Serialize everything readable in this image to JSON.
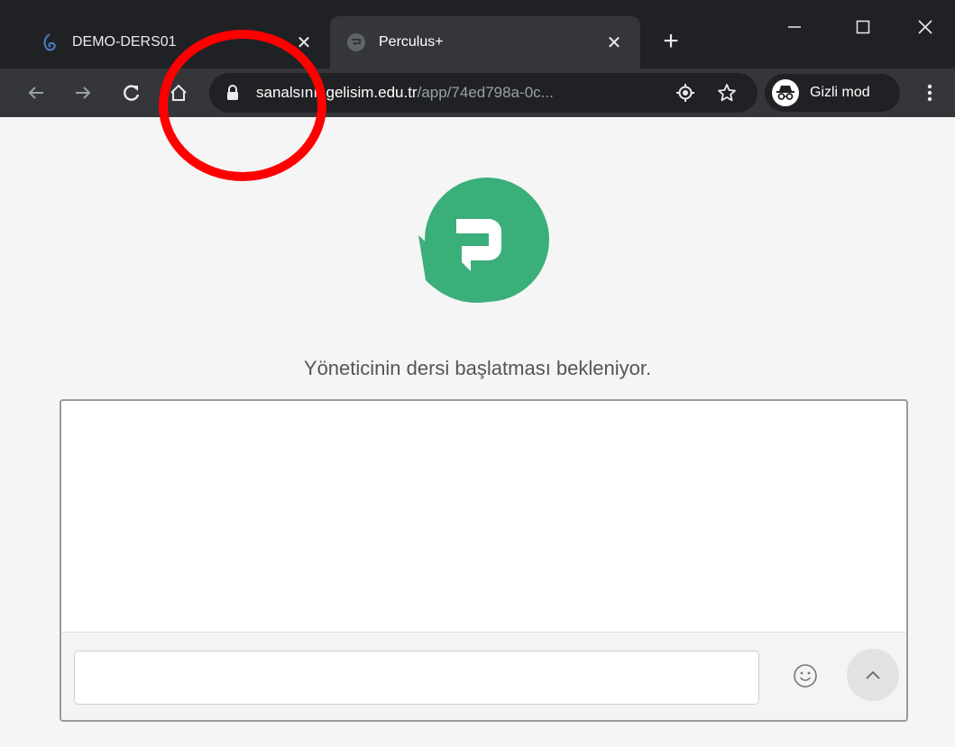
{
  "browser": {
    "tabs": [
      {
        "title": "DEMO-DERS01",
        "favicon": "perculus-swirl-icon",
        "active": false
      },
      {
        "title": "Perculus+",
        "favicon": "perculus-tab-icon",
        "active": true
      }
    ],
    "address": {
      "host": "sanalsınıf.gelisim.edu.tr",
      "path": "/app/74ed798a-0c..."
    },
    "incognito_label": "Gizli mod"
  },
  "page": {
    "status_text": "Yöneticinin dersi başlatması bekleniyor.",
    "chat": {
      "input_value": ""
    }
  },
  "colors": {
    "brand_green": "#3aaf7a",
    "annotation_red": "#ff0000"
  }
}
